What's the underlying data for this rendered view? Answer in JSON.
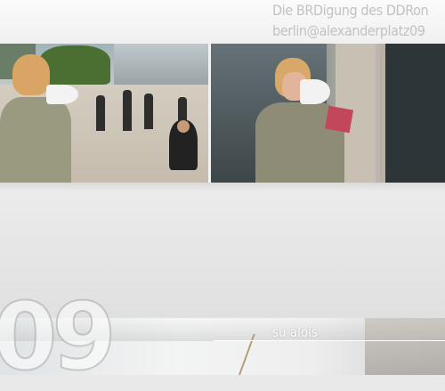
{
  "header": {
    "title": "Die BRDigung des DDRon",
    "subtitle": "berlin@alexanderplatz09"
  },
  "footer": {
    "big_number": "09",
    "nav_link": "su alois"
  }
}
